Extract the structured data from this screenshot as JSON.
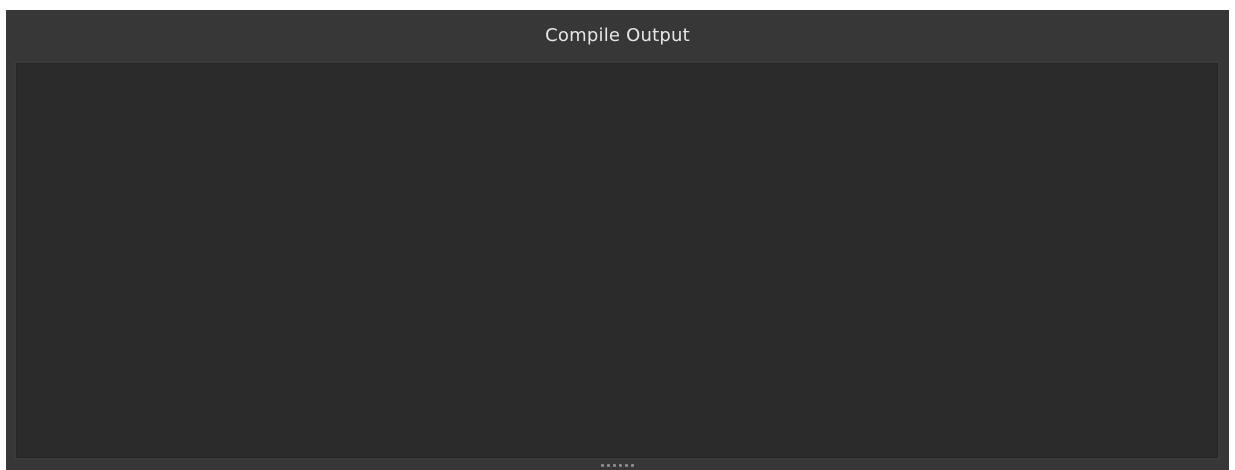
{
  "panel": {
    "title": "Compile Output",
    "output_text": ""
  },
  "grip": {
    "icon": "resize-grip-icon"
  },
  "colors": {
    "panel_background": "#373737",
    "output_background": "#2b2b2b",
    "title_text": "#e6e6e6"
  }
}
